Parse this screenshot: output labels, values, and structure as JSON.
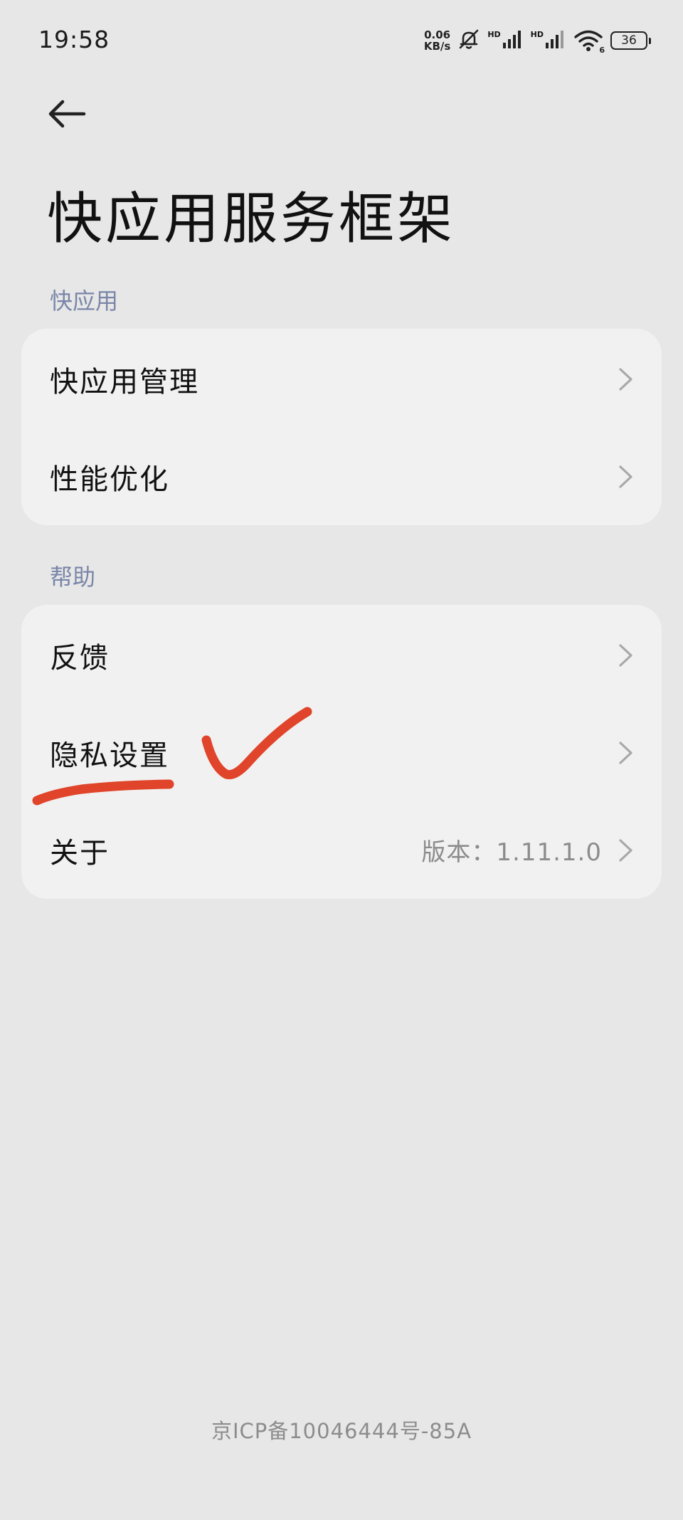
{
  "status_bar": {
    "time": "19:58",
    "net_speed_value": "0.06",
    "net_speed_unit": "KB/s",
    "sim1_label": "HD",
    "sim2_label": "HD",
    "wifi_badge": "6",
    "battery": "36"
  },
  "header": {
    "title": "快应用服务框架"
  },
  "sections": [
    {
      "header": "快应用",
      "items": [
        {
          "label": "快应用管理"
        },
        {
          "label": "性能优化"
        }
      ]
    },
    {
      "header": "帮助",
      "items": [
        {
          "label": "反馈"
        },
        {
          "label": "隐私设置"
        },
        {
          "label": "关于",
          "value": "版本：1.11.1.0"
        }
      ]
    }
  ],
  "footer": {
    "icp": "京ICP备10046444号-85A"
  },
  "annotation": {
    "color": "#e0442a"
  },
  "icons": {
    "back": "arrow-left-icon",
    "chevron": "chevron-right-icon",
    "mute": "bell-off-icon",
    "signal": "signal-bars-icon",
    "wifi": "wifi-icon",
    "battery": "battery-icon"
  }
}
